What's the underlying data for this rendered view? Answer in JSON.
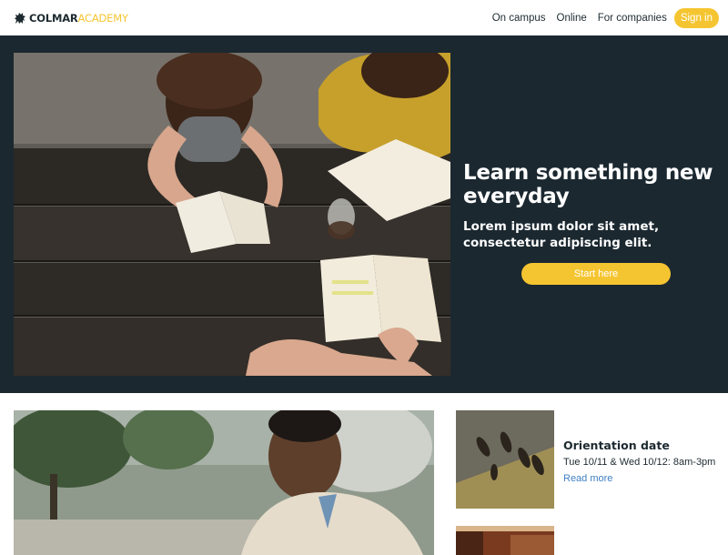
{
  "header": {
    "logo_part1": "COLMAR",
    "logo_part2": "ACADEMY",
    "nav": [
      "On campus",
      "Online",
      "For companies"
    ],
    "sign_in_label": "Sign in"
  },
  "hero": {
    "title": "Learn something new everyday",
    "subtitle": "Lorem ipsum dolor sit amet, consectetur adipiscing elit.",
    "cta_label": "Start here"
  },
  "events": [
    {
      "title": "Orientation date",
      "date": "Tue 10/11 & Wed 10/12: 8am-3pm",
      "link_label": "Read more"
    }
  ],
  "colors": {
    "hero_background": "#1b2830",
    "accent": "#f5c531",
    "text_dark": "#1d2a30",
    "link": "#3f7fc4"
  },
  "icons": [
    "lion-logo-icon"
  ]
}
